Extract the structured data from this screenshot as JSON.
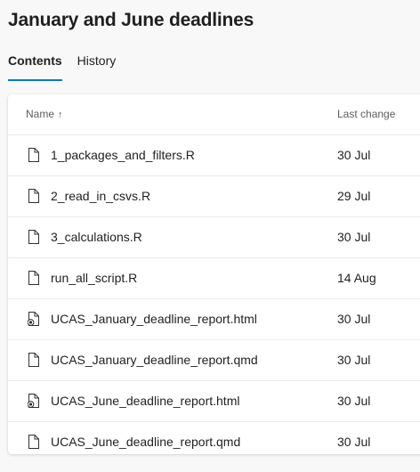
{
  "page": {
    "title": "January and June deadlines"
  },
  "tabs": [
    {
      "label": "Contents",
      "active": true
    },
    {
      "label": "History",
      "active": false
    }
  ],
  "table": {
    "columns": {
      "name": "Name",
      "name_sort_icon": "arrow-up-icon",
      "last_change": "Last change"
    },
    "rows": [
      {
        "name": "1_packages_and_filters.R",
        "last_change": "30 Jul",
        "icon": "file-icon"
      },
      {
        "name": "2_read_in_csvs.R",
        "last_change": "29 Jul",
        "icon": "file-icon"
      },
      {
        "name": "3_calculations.R",
        "last_change": "30 Jul",
        "icon": "file-icon"
      },
      {
        "name": "run_all_script.R",
        "last_change": "14 Aug",
        "icon": "file-icon"
      },
      {
        "name": "UCAS_January_deadline_report.html",
        "last_change": "30 Jul",
        "icon": "file-web-icon"
      },
      {
        "name": "UCAS_January_deadline_report.qmd",
        "last_change": "30 Jul",
        "icon": "file-icon"
      },
      {
        "name": "UCAS_June_deadline_report.html",
        "last_change": "30 Jul",
        "icon": "file-web-icon"
      },
      {
        "name": "UCAS_June_deadline_report.qmd",
        "last_change": "30 Jul",
        "icon": "file-icon"
      }
    ]
  },
  "colors": {
    "accent": "#0078d4",
    "text": "#201f1e",
    "secondary_text": "#605e5c",
    "background": "#f8f8f8",
    "card": "#ffffff"
  }
}
